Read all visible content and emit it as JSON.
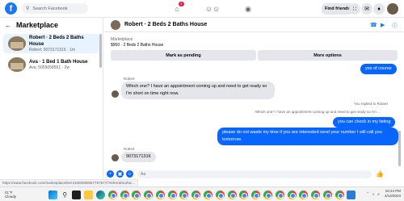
{
  "topbar": {
    "logo": "f",
    "search_placeholder": "Search Facebook",
    "find_friends": "Find friends",
    "notification_badge": "1"
  },
  "marketplace": {
    "header": "Marketplace",
    "threads": [
      {
        "title": "Robert · 2 Beds 2 Baths House",
        "sub": "Robert: 9073171316 · 1m"
      },
      {
        "title": "Ava · 1 Bed 1 Bath House",
        "sub": "Ava: 5055058551 · 2w"
      }
    ]
  },
  "chat": {
    "title": "Robert · 2 Beds 2 Baths House",
    "item_label": "Marketplace",
    "item_price": "$950 · 2 Beds 2 Baths House",
    "mark_pending": "Mark as pending",
    "more_options": "More options",
    "messages": {
      "m1": "yes of course",
      "sender1": "Robert",
      "m2": "Which one? I have an appointment coming up and need to get ready so I'm short on time right now.",
      "reply_note": "You replied to Robert",
      "quoted": "Which one? I have an appointment coming up and need to get ready so I'm ...",
      "m3": "you can check in my listing",
      "m4": "please do not waste my time if you are interested send your number I will call you tomorrow.",
      "sender2": "Robert",
      "m5": "9073171316"
    },
    "input_placeholder": "Aa"
  },
  "status_url": "https://www.facebook.com/marketplace/item/1000089857757977/?referralSurfac...",
  "taskbar": {
    "weather_line1": "41°F",
    "weather_line2": "Cloudy",
    "time": "10:24 PM",
    "date": "4/14/2023"
  }
}
